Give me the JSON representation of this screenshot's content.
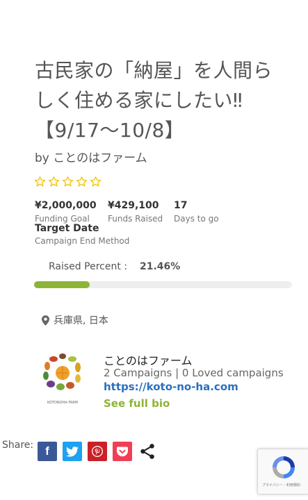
{
  "campaign": {
    "title_line1": "古民家の「納屋」を人間ら",
    "title_line2": "しく住める家にしたい‼",
    "title_line3": "【9/17〜10/8】",
    "by_prefix": "by",
    "author": "ことのはファーム",
    "rating_stars": 5,
    "rating_value": 0
  },
  "stats": {
    "funding_goal_value": "¥2,000,000",
    "funding_goal_label": "Funding Goal",
    "funds_raised_value": "¥429,100",
    "funds_raised_label": "Funds Raised",
    "days_value": "17",
    "days_label": "Days to go",
    "target_value": "Target Date",
    "target_label": "Campaign End Method"
  },
  "progress": {
    "label": "Raised Percent :",
    "percent_text": "21.46%",
    "percent": 21.46
  },
  "location": "兵庫県, 日本",
  "author_card": {
    "name": "ことのはファーム",
    "stats": "2 Campaigns | 0 Loved campaigns",
    "url": "https://koto-no-ha.com",
    "bio_link": "See full bio",
    "logo_text": "KOTONOHA FARM"
  },
  "share": {
    "label": "Share:",
    "facebook_icon": "f"
  },
  "recaptcha": {
    "text": "プライバシー - 利用規約"
  },
  "colors": {
    "accent_green": "#8cb436",
    "link_blue": "#2b6fbf",
    "facebook": "#3b5998",
    "twitter": "#1da1f2",
    "pinterest": "#cb2027",
    "pocket": "#ef3f56"
  }
}
